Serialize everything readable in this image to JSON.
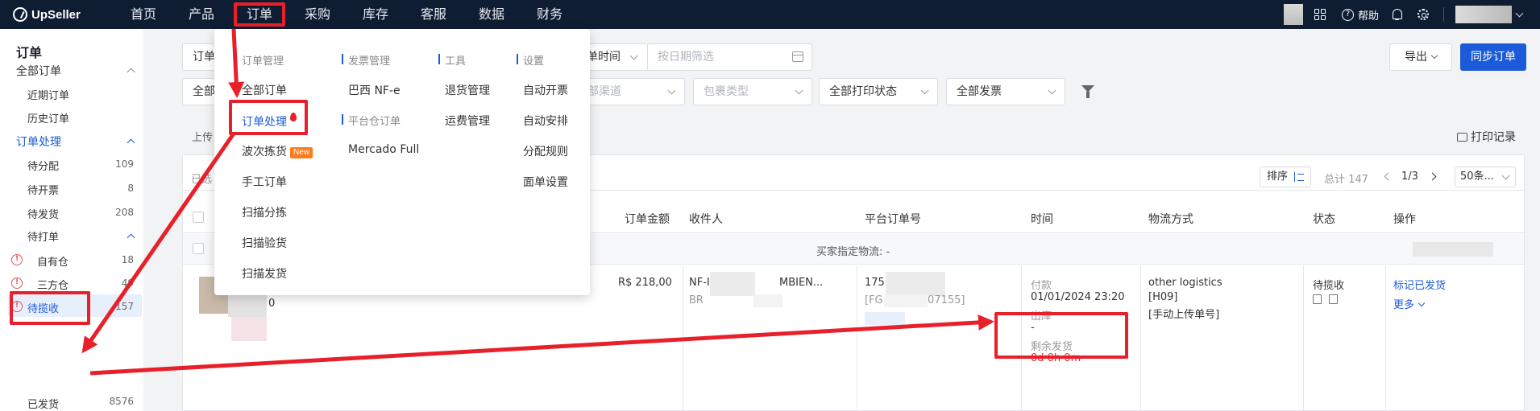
{
  "topnav": {
    "brand": "UpSeller",
    "items": [
      {
        "label": "首页"
      },
      {
        "label": "产品"
      },
      {
        "label": "订单",
        "active": true
      },
      {
        "label": "采购"
      },
      {
        "label": "库存"
      },
      {
        "label": "客服"
      },
      {
        "label": "数据"
      },
      {
        "label": "财务"
      }
    ],
    "help": "帮助"
  },
  "sidebar": {
    "title": "订单",
    "all_orders": "全部订单",
    "recent": "近期订单",
    "history": "历史订单",
    "processing": "订单处理",
    "to_allocate": {
      "label": "待分配",
      "count": "109"
    },
    "to_invoice": {
      "label": "待开票",
      "count": "8"
    },
    "to_ship": {
      "label": "待发货",
      "count": "208"
    },
    "to_print": "待打单",
    "own_wh": {
      "label": "自有仓",
      "count": "18"
    },
    "third_wh": {
      "label": "三方仓",
      "count": "49"
    },
    "to_pickup": {
      "label": "待揽收",
      "count": "157"
    },
    "shipped": {
      "label": "已发货",
      "count": "8576"
    }
  },
  "filters": {
    "order_type_partial": "订单",
    "all_partial": "全部",
    "order_time_partial": "单时间",
    "date_placeholder": "按日期筛选",
    "channel_partial": "部渠道",
    "package_type": "包裹类型",
    "print_status": "全部打印状态",
    "invoice": "全部发票"
  },
  "actions": {
    "export": "导出",
    "sync": "同步订单",
    "print_log": "打印记录",
    "upload_partial": "上传"
  },
  "table": {
    "selected_partial": "已选",
    "sort": "排序",
    "total": "总计 147",
    "page": "1/3",
    "per_page": "50条...",
    "headers": {
      "amount": "订单金额",
      "recipient": "收件人",
      "platform_no": "平台订单号",
      "time": "时间",
      "logistics": "物流方式",
      "status": "状态",
      "ops": "操作"
    },
    "group_label": "买家指定物流: -",
    "row": {
      "qty_partial": "0",
      "amount": "R$ 218,00",
      "recipient_a": "NF-I",
      "recipient_b": "MBIEN...",
      "recipient_country": "BR",
      "platform_a": "175",
      "platform_b_prefix": "[FG",
      "platform_b_suffix": "07155]",
      "time_pay_label": "付款",
      "time_pay": "01/01/2024 23:20",
      "time_out_label": "出库",
      "time_out": "-",
      "time_remain_label": "剩余发货",
      "time_remain": "0d 0h 0m",
      "logistics_1": "other logistics",
      "logistics_2": "[H09]",
      "logistics_3": "[手动上传单号]",
      "status": "待揽收",
      "op_mark": "标记已发货",
      "op_more": "更多"
    }
  },
  "dropdown": {
    "col1": {
      "head": "订单管理",
      "items": [
        "全部订单",
        "订单处理",
        "波次拣货",
        "手工订单",
        "扫描分拣",
        "扫描验货",
        "扫描发货"
      ],
      "new_badge": "New"
    },
    "col2": {
      "head": "发票管理",
      "items": [
        "巴西 NF-e"
      ],
      "head2": "平台仓订单",
      "items2": [
        "Mercado Full"
      ]
    },
    "col3": {
      "head": "工具",
      "items": [
        "退货管理",
        "运费管理"
      ]
    },
    "col4": {
      "head": "设置",
      "items": [
        "自动开票",
        "自动安排",
        "分配规则",
        "面单设置"
      ]
    }
  },
  "colors": {
    "nav_bg": "#0f1d33",
    "primary": "#1b5ad8",
    "annotation_red": "#e8202a"
  }
}
